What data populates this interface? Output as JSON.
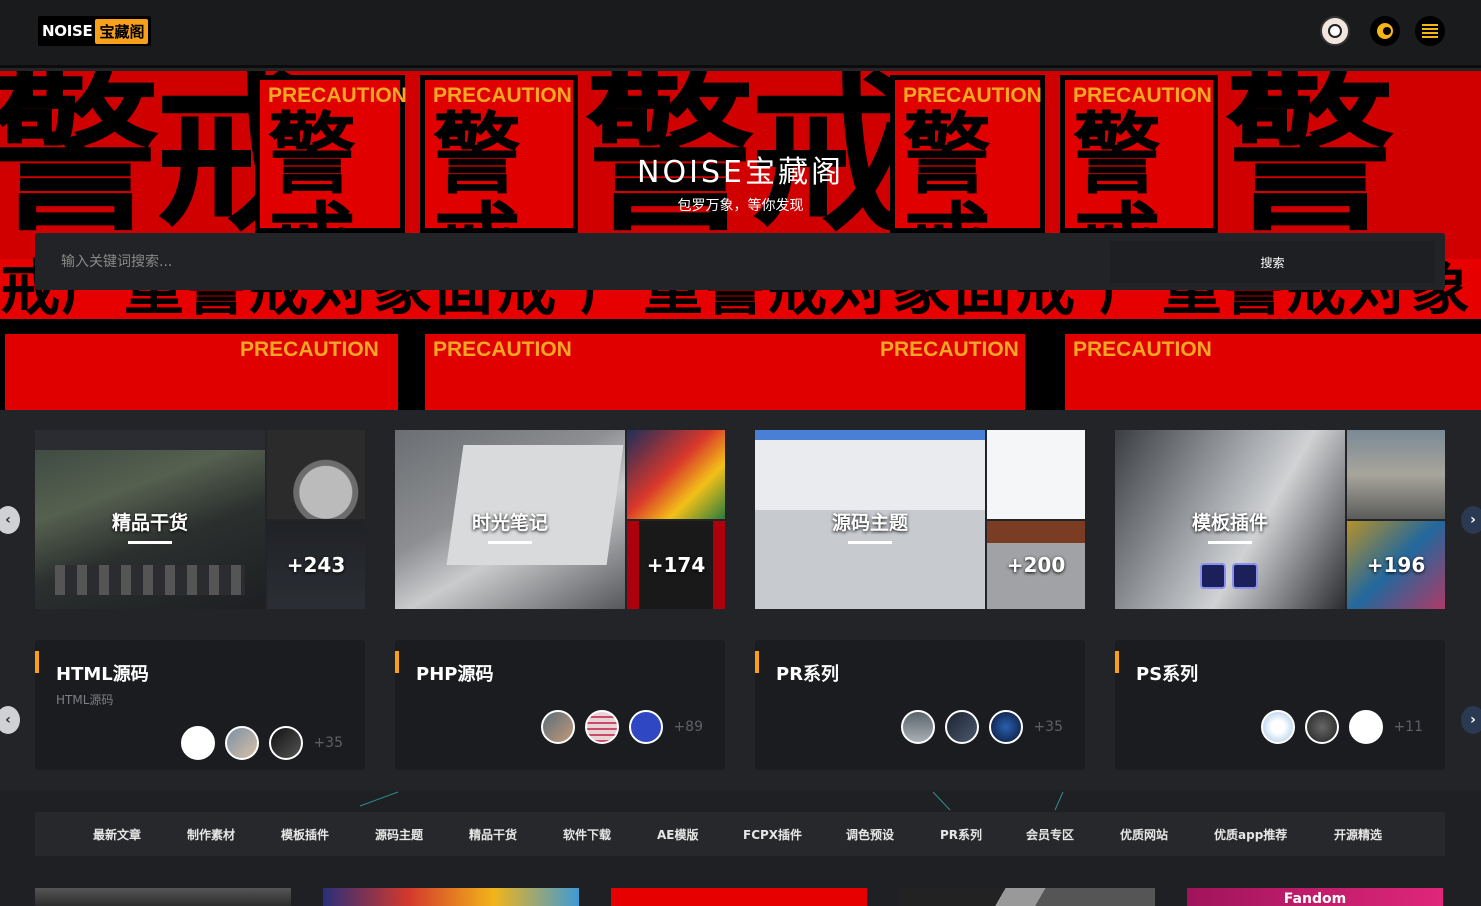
{
  "header": {
    "logo_en": "NOISE",
    "logo_cn": "宝藏阁"
  },
  "banner": {
    "title": "NOISE宝藏阁",
    "subtitle": "包罗万象，等你发现",
    "bg_text_pc": "PRECAUTION",
    "bg_text_big": "警戒",
    "bg_text_row": "戒严重警戒对象面戒 严重警戒对象面戒 严重警戒对象"
  },
  "search": {
    "placeholder": "输入关键词搜索...",
    "button": "搜索"
  },
  "categories": [
    {
      "label": "精品干货",
      "more": "+243"
    },
    {
      "label": "时光笔记",
      "more": "+174"
    },
    {
      "label": "源码主题",
      "more": "+200"
    },
    {
      "label": "模板插件",
      "more": "+196"
    }
  ],
  "collections": [
    {
      "title": "HTML源码",
      "subtitle": "HTML源码",
      "count": "+35"
    },
    {
      "title": "PHP源码",
      "subtitle": "",
      "count": "+89"
    },
    {
      "title": "PR系列",
      "subtitle": "",
      "count": "+35"
    },
    {
      "title": "PS系列",
      "subtitle": "",
      "count": "+11"
    }
  ],
  "nav": [
    "最新文章",
    "制作素材",
    "模板插件",
    "源码主题",
    "精品干货",
    "软件下载",
    "AE模版",
    "FCPX插件",
    "调色预设",
    "PR系列",
    "会员专区",
    "优质网站",
    "优质app推荐",
    "开源精选"
  ],
  "bottom_thumb_text": "Fandom",
  "colors": {
    "accent": "#f7a11a",
    "banner_red": "#e00000",
    "bg": "#232427",
    "card": "#1b1c1f"
  },
  "icons": {
    "left_arrow": "chevron-left-icon",
    "right_arrow": "chevron-right-icon",
    "theme": "moon-icon",
    "menu": "list-icon"
  }
}
